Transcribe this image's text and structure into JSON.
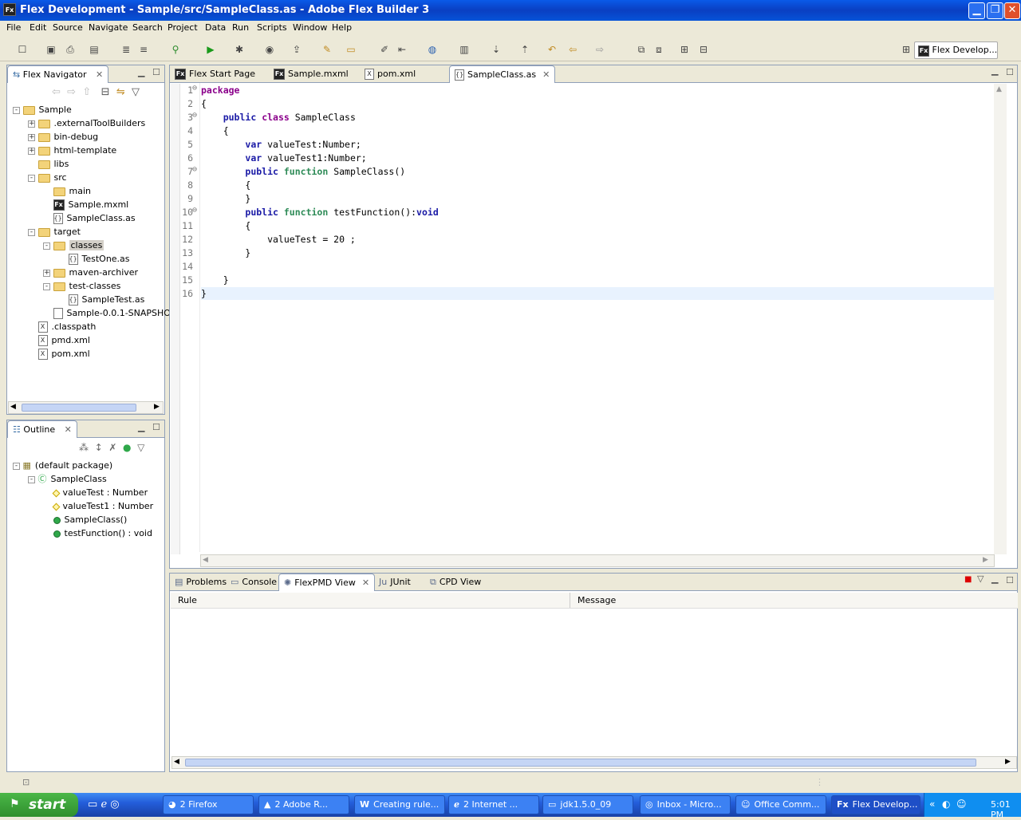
{
  "window": {
    "title": "Flex Development - Sample/src/SampleClass.as - Adobe Flex Builder 3",
    "icon": "Fx"
  },
  "menu": [
    "File",
    "Edit",
    "Source",
    "Navigate",
    "Search",
    "Project",
    "Data",
    "Run",
    "Scripts",
    "Window",
    "Help"
  ],
  "perspective": {
    "label": "Flex Develop...",
    "icon": "Fx"
  },
  "navigator": {
    "title": "Flex Navigator",
    "items": [
      {
        "label": "Sample",
        "depth": 0,
        "exp": "-",
        "kind": "project"
      },
      {
        "label": ".externalToolBuilders",
        "depth": 1,
        "exp": "+",
        "kind": "folder"
      },
      {
        "label": "bin-debug",
        "depth": 1,
        "exp": "+",
        "kind": "folder"
      },
      {
        "label": "html-template",
        "depth": 1,
        "exp": "+",
        "kind": "folder"
      },
      {
        "label": "libs",
        "depth": 1,
        "exp": "",
        "kind": "folder"
      },
      {
        "label": "src",
        "depth": 1,
        "exp": "-",
        "kind": "folder"
      },
      {
        "label": "main",
        "depth": 2,
        "exp": "",
        "kind": "folder"
      },
      {
        "label": "Sample.mxml",
        "depth": 2,
        "exp": "",
        "kind": "fx"
      },
      {
        "label": "SampleClass.as",
        "depth": 2,
        "exp": "",
        "kind": "as"
      },
      {
        "label": "target",
        "depth": 1,
        "exp": "-",
        "kind": "folder"
      },
      {
        "label": "classes",
        "depth": 2,
        "exp": "-",
        "kind": "folder",
        "selected": true
      },
      {
        "label": "TestOne.as",
        "depth": 3,
        "exp": "",
        "kind": "as"
      },
      {
        "label": "maven-archiver",
        "depth": 2,
        "exp": "+",
        "kind": "folder"
      },
      {
        "label": "test-classes",
        "depth": 2,
        "exp": "-",
        "kind": "folder"
      },
      {
        "label": "SampleTest.as",
        "depth": 3,
        "exp": "",
        "kind": "as"
      },
      {
        "label": "Sample-0.0.1-SNAPSHO",
        "depth": 2,
        "exp": "",
        "kind": "file"
      },
      {
        "label": ".classpath",
        "depth": 1,
        "exp": "",
        "kind": "xml"
      },
      {
        "label": "pmd.xml",
        "depth": 1,
        "exp": "",
        "kind": "xml"
      },
      {
        "label": "pom.xml",
        "depth": 1,
        "exp": "",
        "kind": "xml"
      }
    ]
  },
  "outline": {
    "title": "Outline",
    "items": [
      {
        "label": "(default package)",
        "depth": 0,
        "exp": "-",
        "kind": "pkg"
      },
      {
        "label": "SampleClass",
        "depth": 1,
        "exp": "-",
        "kind": "class"
      },
      {
        "label": "valueTest : Number",
        "depth": 2,
        "exp": "",
        "kind": "var"
      },
      {
        "label": "valueTest1 : Number",
        "depth": 2,
        "exp": "",
        "kind": "var"
      },
      {
        "label": "SampleClass()",
        "depth": 2,
        "exp": "",
        "kind": "method"
      },
      {
        "label": "testFunction() : void",
        "depth": 2,
        "exp": "",
        "kind": "method"
      }
    ]
  },
  "editor": {
    "tabs": [
      {
        "label": "Flex Start Page",
        "icon": "Fx"
      },
      {
        "label": "Sample.mxml",
        "icon": "Fx"
      },
      {
        "label": "pom.xml",
        "icon": "X"
      },
      {
        "label": "SampleClass.as",
        "icon": "{}",
        "active": true
      }
    ],
    "lines": [
      {
        "n": "1",
        "fold": true,
        "tokens": [
          [
            "pk",
            "package"
          ]
        ]
      },
      {
        "n": "2",
        "tokens": [
          [
            "",
            "{"
          ]
        ]
      },
      {
        "n": "3",
        "fold": true,
        "tokens": [
          [
            "",
            "    "
          ],
          [
            "kw",
            "public"
          ],
          [
            "",
            " "
          ],
          [
            "pk",
            "class"
          ],
          [
            "",
            " SampleClass"
          ]
        ]
      },
      {
        "n": "4",
        "tokens": [
          [
            "",
            "    {"
          ]
        ]
      },
      {
        "n": "5",
        "tokens": [
          [
            "",
            "        "
          ],
          [
            "kw",
            "var"
          ],
          [
            "",
            " valueTest:Number;"
          ]
        ]
      },
      {
        "n": "6",
        "tokens": [
          [
            "",
            "        "
          ],
          [
            "kw",
            "var"
          ],
          [
            "",
            " valueTest1:Number;"
          ]
        ]
      },
      {
        "n": "7",
        "fold": true,
        "tokens": [
          [
            "",
            "        "
          ],
          [
            "kw",
            "public"
          ],
          [
            "",
            " "
          ],
          [
            "fn",
            "function"
          ],
          [
            "",
            " SampleClass()"
          ]
        ]
      },
      {
        "n": "8",
        "tokens": [
          [
            "",
            "        {"
          ]
        ]
      },
      {
        "n": "9",
        "tokens": [
          [
            "",
            "        }"
          ]
        ]
      },
      {
        "n": "10",
        "fold": true,
        "tokens": [
          [
            "",
            "        "
          ],
          [
            "kw",
            "public"
          ],
          [
            "",
            " "
          ],
          [
            "fn",
            "function"
          ],
          [
            "",
            " testFunction():"
          ],
          [
            "kw",
            "void"
          ]
        ]
      },
      {
        "n": "11",
        "tokens": [
          [
            "",
            "        {"
          ]
        ]
      },
      {
        "n": "12",
        "tokens": [
          [
            "",
            "            valueTest = 20 ;"
          ]
        ]
      },
      {
        "n": "13",
        "tokens": [
          [
            "",
            "        }"
          ]
        ]
      },
      {
        "n": "14",
        "tokens": [
          [
            "",
            ""
          ]
        ]
      },
      {
        "n": "15",
        "tokens": [
          [
            "",
            "    }"
          ]
        ]
      },
      {
        "n": "16",
        "current": true,
        "tokens": [
          [
            "",
            "}"
          ]
        ]
      }
    ]
  },
  "bottom": {
    "tabs": [
      {
        "label": "Problems"
      },
      {
        "label": "Console"
      },
      {
        "label": "FlexPMD View",
        "active": true
      },
      {
        "label": "JUnit"
      },
      {
        "label": "CPD View"
      }
    ],
    "columns": [
      "Rule",
      "Message"
    ]
  },
  "taskbar": {
    "start": "start",
    "tasks": [
      "2 Firefox",
      "2 Adobe R...",
      "Creating rule...",
      "2 Internet ...",
      "jdk1.5.0_09",
      "Inbox - Micro...",
      "Office Comm...",
      "Flex Develop..."
    ],
    "clock": "5:01 PM"
  }
}
